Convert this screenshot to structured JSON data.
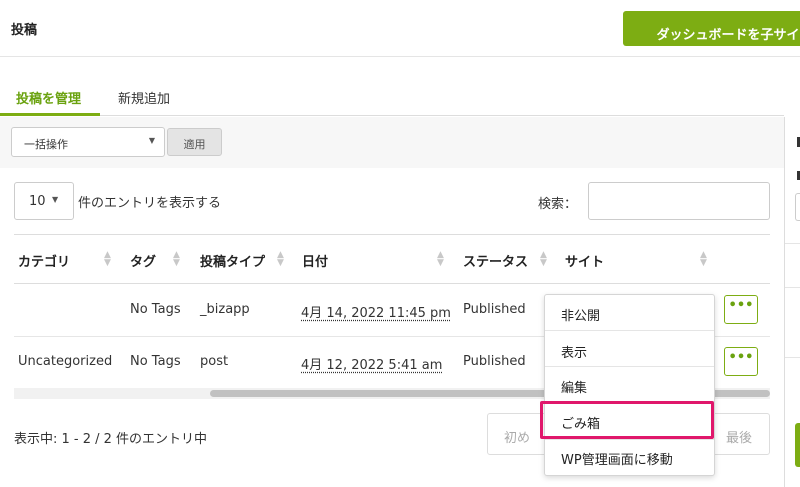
{
  "header": {
    "title": "投稿",
    "dashboard_button": "ダッシュボードを子サイ"
  },
  "tabs": [
    {
      "label": "投稿を管理",
      "active": true
    },
    {
      "label": "新規追加",
      "active": false
    }
  ],
  "bulk": {
    "selected": "一括操作",
    "apply_label": "適用"
  },
  "table_controls": {
    "length_value": "10",
    "length_label": "件のエントリを表示する",
    "search_label": "検索："
  },
  "columns": [
    "カテゴリ",
    "タグ",
    "投稿タイプ",
    "日付",
    "ステータス",
    "サイト"
  ],
  "rows": [
    {
      "category": "",
      "tags": "No Tags",
      "type": "_bizapp",
      "date": "4月 14, 2022 11:45 pm",
      "status": "Published",
      "site": "",
      "action": "•••"
    },
    {
      "category": "Uncategorized",
      "tags": "No Tags",
      "type": "post",
      "date": "4月 12, 2022 5:41 am",
      "status": "Published",
      "site": "",
      "action": "•••"
    }
  ],
  "footer": {
    "info": "表示中: 1 - 2 / 2 件のエントリ中",
    "first": "初め",
    "last": "最後"
  },
  "context_menu": {
    "items": [
      "非公開",
      "表示",
      "編集",
      "ごみ箱",
      "WP管理画面に移動"
    ],
    "highlighted": "ごみ箱"
  },
  "colors": {
    "accent": "#7dad13",
    "highlight_border": "#e0176b"
  }
}
